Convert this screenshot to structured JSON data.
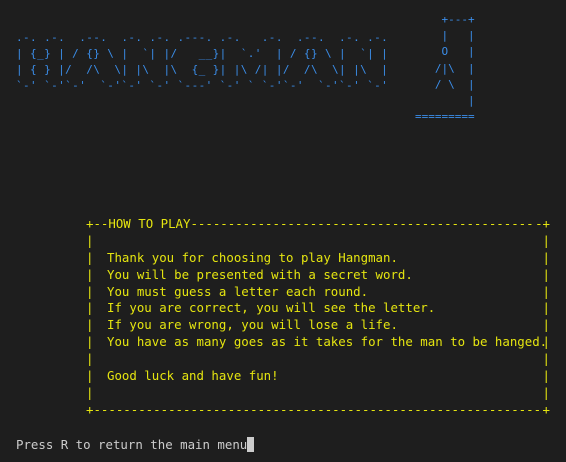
{
  "logo": {
    "ascii_art": ".-. .-.  .--.  .-. .-. .---. .-.   .-.  .--.  .-. .-.\n| {_} | / {} \\ |  `| |/   __}|  `.'  | / {} \\ |  `| |\n| { } |/  /\\  \\| |\\  |\\  {_ }| |\\ /| |/  /\\  \\| |\\  |\n`-' `-'`-'  `-'`-' `-' `---' `-' ` `-'`-'  `-'`-' `-'"
  },
  "gallows": {
    "ascii_art": "    +---+\n    |   |\n    O   |\n   /|\\  |\n   / \\  |\n        |\n========="
  },
  "how_to_play": {
    "title": "HOW TO PLAY",
    "top_left_corner": "+--",
    "top_right_corner": "-+",
    "bottom_line": "+----------------------------------------------------------+",
    "side_border": "|",
    "lines": [
      "",
      "Thank you for choosing to play Hangman.",
      "You will be presented with a secret word.",
      "You must guess a letter each round.",
      "If you are correct, you will see the letter.",
      "If you are wrong, you will lose a life.",
      "You have as many goes as it takes for the man to be hanged.",
      "",
      "Good luck and have fun!",
      ""
    ]
  },
  "prompt": {
    "text": "Press R to return the main menu"
  },
  "colors": {
    "background": "#1e1e1e",
    "logo": "#3b8eea",
    "panel_text": "#e5e510",
    "prompt_text": "#cccccc"
  }
}
